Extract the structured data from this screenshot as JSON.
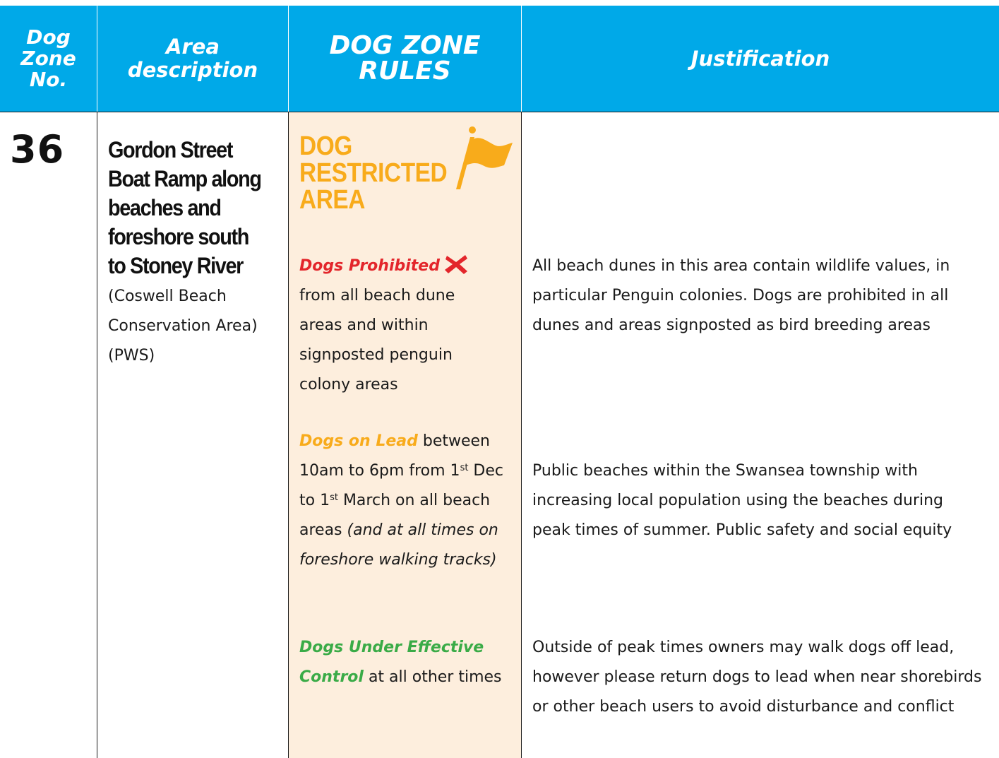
{
  "header": {
    "col1": "Dog Zone No.",
    "col2": "Area description",
    "col3": "DOG ZONE RULES",
    "col4": "Justification"
  },
  "row": {
    "zone_no": "36",
    "area_title": "Gordon Street\nBoat Ramp along\nbeaches and\nforeshore south\nto Stoney River",
    "area_sub": "(Coswell Beach\nConservation Area)\n(PWS)",
    "zone_type": "DOG\nRESTRICTED\nAREA",
    "rules": {
      "prohibited_lead": "Dogs Prohibited",
      "prohibited_text": "from all beach dune areas and within signposted penguin colony areas",
      "lead_lead": "Dogs on Lead",
      "lead_text_a": " between 10am to 6pm from 1",
      "lead_sup1": "st",
      "lead_text_b": " Dec to 1",
      "lead_sup2": "st",
      "lead_text_c": " March on all beach areas ",
      "lead_text_italic": "(and at all times on foreshore walking tracks)",
      "control_lead": "Dogs Under Effective Control",
      "control_text": " at all other times"
    },
    "justification": {
      "j1": "All beach dunes in this area contain wildlife values, in particular Penguin colonies. Dogs are prohibited in all dunes and areas signposted as bird breeding areas",
      "j2": "Public beaches within the Swansea township with increasing local population using the beaches during peak times of summer. Public safety and social equity",
      "j3": "Outside of peak times owners may walk dogs off lead, however please return dogs to lead when near shorebirds or other beach users to avoid disturbance and conflict"
    }
  },
  "icons": {
    "flag": "flag-icon",
    "prohibited": "cross-icon"
  },
  "colors": {
    "header_bg": "#00a9e8",
    "restricted": "#f8ab1b",
    "prohibited": "#e3262b",
    "control": "#3aab47",
    "rules_bg": "#fdeedd"
  }
}
